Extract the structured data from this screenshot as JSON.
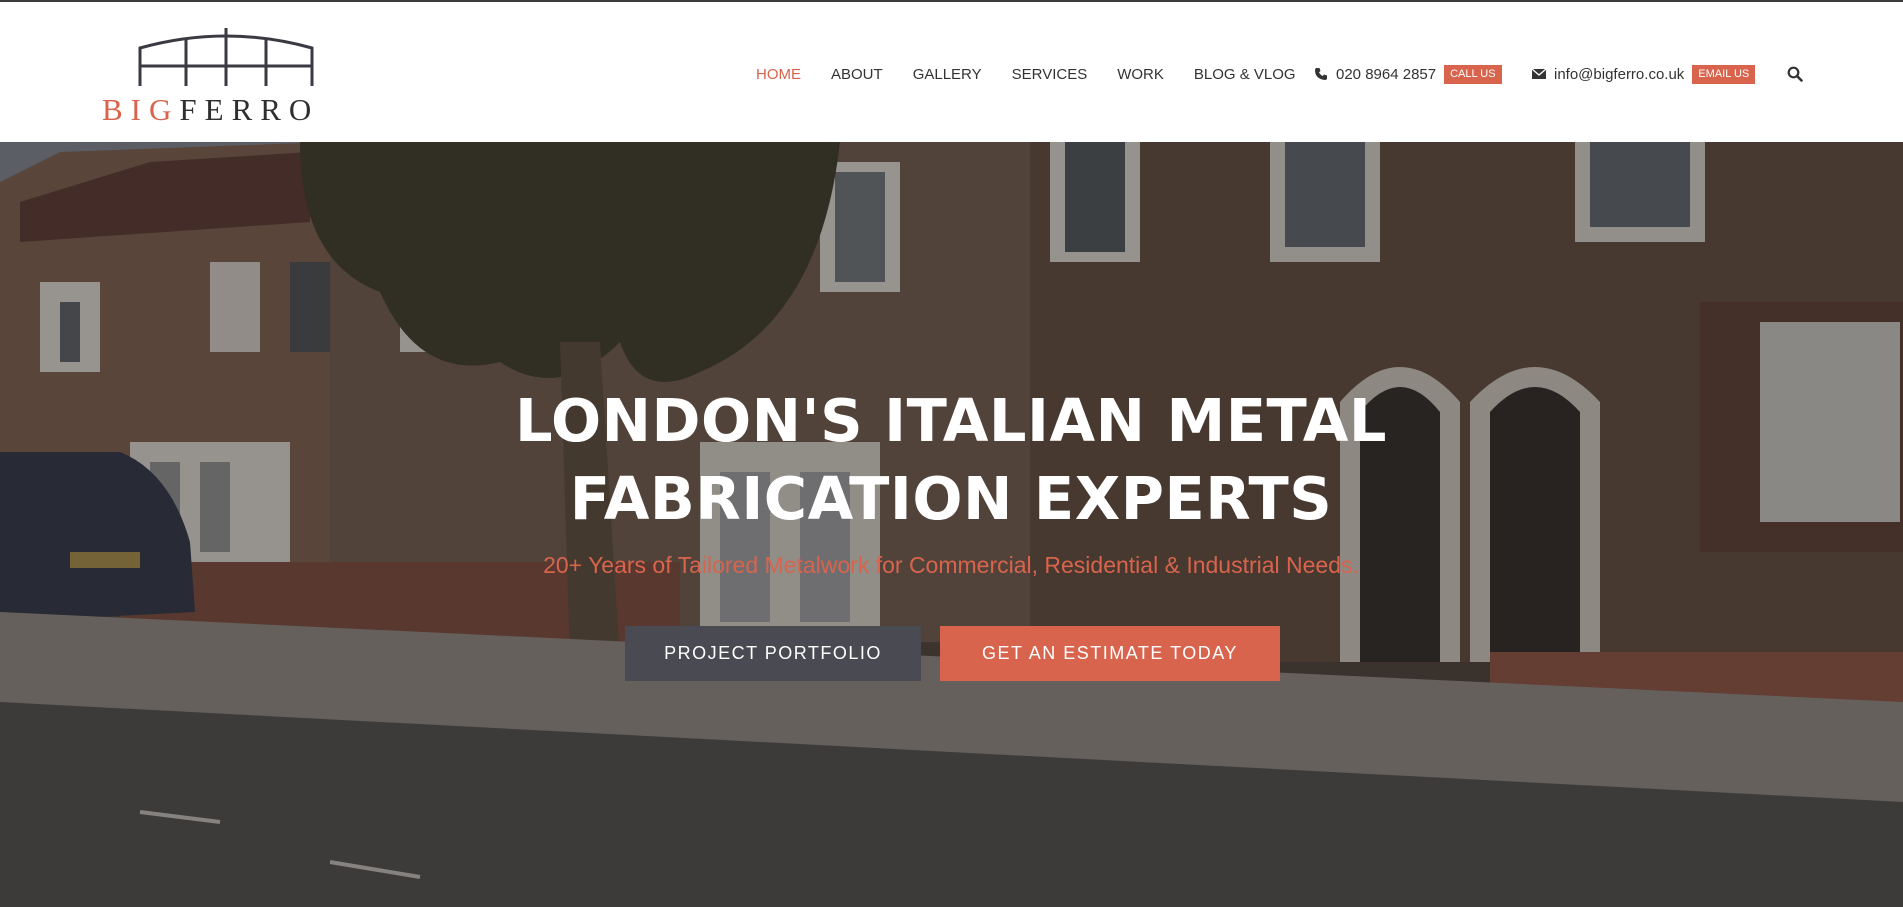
{
  "brand": {
    "logo_big": "BIG",
    "logo_ferro": "FERRO"
  },
  "nav": {
    "items": [
      {
        "label": "HOME",
        "active": true
      },
      {
        "label": "ABOUT"
      },
      {
        "label": "GALLERY"
      },
      {
        "label": "SERVICES"
      },
      {
        "label": "WORK"
      },
      {
        "label": "BLOG & VLOG"
      }
    ]
  },
  "contact": {
    "phone": "020 8964 2857",
    "phone_badge": "CALL US",
    "email": "info@bigferro.co.uk",
    "email_badge": "EMAIL US"
  },
  "hero": {
    "title_line1": "LONDON'S ITALIAN METAL",
    "title_line2": "FABRICATION EXPERTS",
    "subtitle": "20+ Years of Tailored Metalwork for Commercial, Residential & Industrial Needs.",
    "primary_button": "PROJECT PORTFOLIO",
    "secondary_button": "GET AN ESTIMATE TODAY"
  },
  "colors": {
    "accent": "#d9644d",
    "dark_button": "#4a4a52",
    "text": "#333333"
  },
  "icons": {
    "phone": "phone-icon",
    "email": "envelope-icon",
    "search": "search-icon"
  }
}
